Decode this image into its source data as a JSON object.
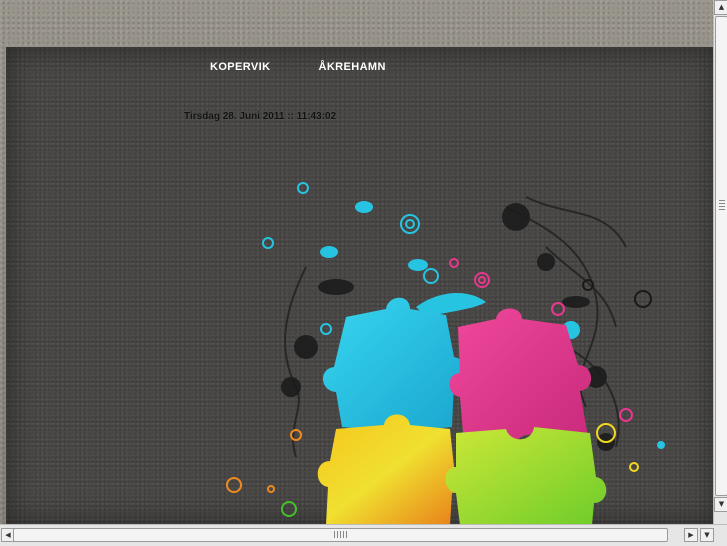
{
  "nav": {
    "items": [
      {
        "label": "KOPERVIK"
      },
      {
        "label": "ÅKREHAMN"
      }
    ]
  },
  "datetime": {
    "text": "Tirsdag 28. Juni 2011 :: 11:43:02"
  },
  "colors": {
    "background_stone": "#8e8a82",
    "panel": "#4a4947",
    "cyan_piece": "#22c6e4",
    "pink_piece": "#e8378f",
    "yellow_piece": "#f1d81e",
    "green_piece": "#a6e02c",
    "orange_piece": "#f08a1c"
  },
  "icons": {
    "scroll_up": "arrow-up-icon",
    "scroll_down": "arrow-down-icon",
    "scroll_left": "arrow-left-icon",
    "scroll_right": "arrow-right-icon"
  }
}
